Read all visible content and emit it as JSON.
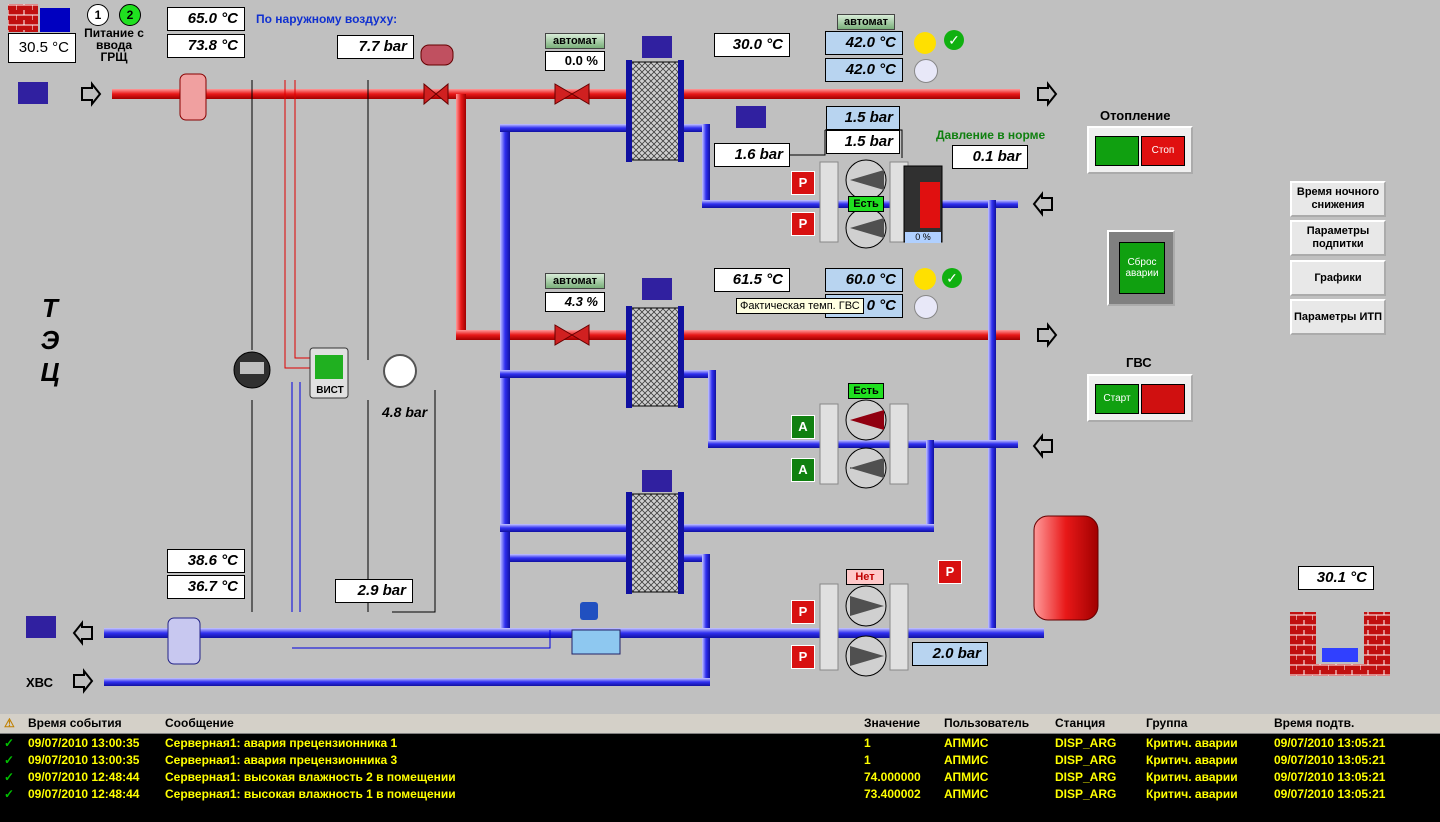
{
  "window_title": "30.5 °C",
  "power": {
    "input1": "1",
    "input2": "2",
    "label": "Питание с ввода ГРЩ"
  },
  "supply_temps": {
    "t1": "65.0 °C",
    "t2": "73.8 °C"
  },
  "outdoor_label": "По наружному воздуху:",
  "pressure_in": "7.7 bar",
  "heating_valve": {
    "mode": "автомат",
    "value": "0.0 %"
  },
  "heating_out_temp": "30.0 °C",
  "heating_setpoint": {
    "mode": "автомат",
    "day": "42.0 °C",
    "night": "42.0 °C"
  },
  "heating_pressures": {
    "p_top": "1.5 bar",
    "p_mid": "1.5 bar",
    "p_left": "1.6 bar",
    "p_right": "0.1 bar"
  },
  "pressure_status": "Давление в норме",
  "heating_pump_status": "Есть",
  "vfd_value": "0 %",
  "heating_panel": {
    "title": "Отопление",
    "stop": "Стоп"
  },
  "side_buttons": [
    "Время ночного снижения",
    "Параметры подпитки",
    "Графики",
    "Параметры ИТП"
  ],
  "reset_button": "Сброс аварии",
  "tec_label": "Т Э Ц",
  "hvs_label": "ХВС",
  "dhw_valve": {
    "mode": "автомат",
    "value": "4.3 %"
  },
  "dhw_out_temp": "61.5 °C",
  "dhw_setpoint": {
    "day": "60.0 °C",
    "night": "0 °C"
  },
  "tooltip": "Фактическая темп. ГВС",
  "vist_label": "ВИСТ",
  "gauge_pressure": "4.8 bar",
  "dhw_pump_status": "Есть",
  "dhw_panel": {
    "title": "ГВС",
    "start": "Старт"
  },
  "return_temps": {
    "t1": "38.6 °C",
    "t2": "36.7 °C"
  },
  "cold_pressure": "2.9 bar",
  "makeup_pump_status": "Нет",
  "makeup_pressure": "2.0 bar",
  "room_temp": "30.1 °C",
  "pump_mode_P": "P",
  "pump_mode_A": "A",
  "events": {
    "headers": [
      "Время события",
      "Сообщение",
      "Значение",
      "Пользователь",
      "Станция",
      "Группа",
      "Время подтв."
    ],
    "rows": [
      {
        "time": "09/07/2010 13:00:35",
        "msg": "Серверная1: авария прецензионника 1",
        "value": "1",
        "user": "АПМИС",
        "station": "DISP_ARG",
        "group": "Критич. аварии",
        "ack": "09/07/2010 13:05:21"
      },
      {
        "time": "09/07/2010 13:00:35",
        "msg": "Серверная1: авария прецензионника 3",
        "value": "1",
        "user": "АПМИС",
        "station": "DISP_ARG",
        "group": "Критич. аварии",
        "ack": "09/07/2010 13:05:21"
      },
      {
        "time": "09/07/2010 12:48:44",
        "msg": "Серверная1: высокая влажность 2 в помещении",
        "value": "74.000000",
        "user": "АПМИС",
        "station": "DISP_ARG",
        "group": "Критич. аварии",
        "ack": "09/07/2010 13:05:21"
      },
      {
        "time": "09/07/2010 12:48:44",
        "msg": "Серверная1: высокая влажность 1 в помещении",
        "value": "73.400002",
        "user": "АПМИС",
        "station": "DISP_ARG",
        "group": "Критич. аварии",
        "ack": "09/07/2010 13:05:21"
      }
    ]
  }
}
